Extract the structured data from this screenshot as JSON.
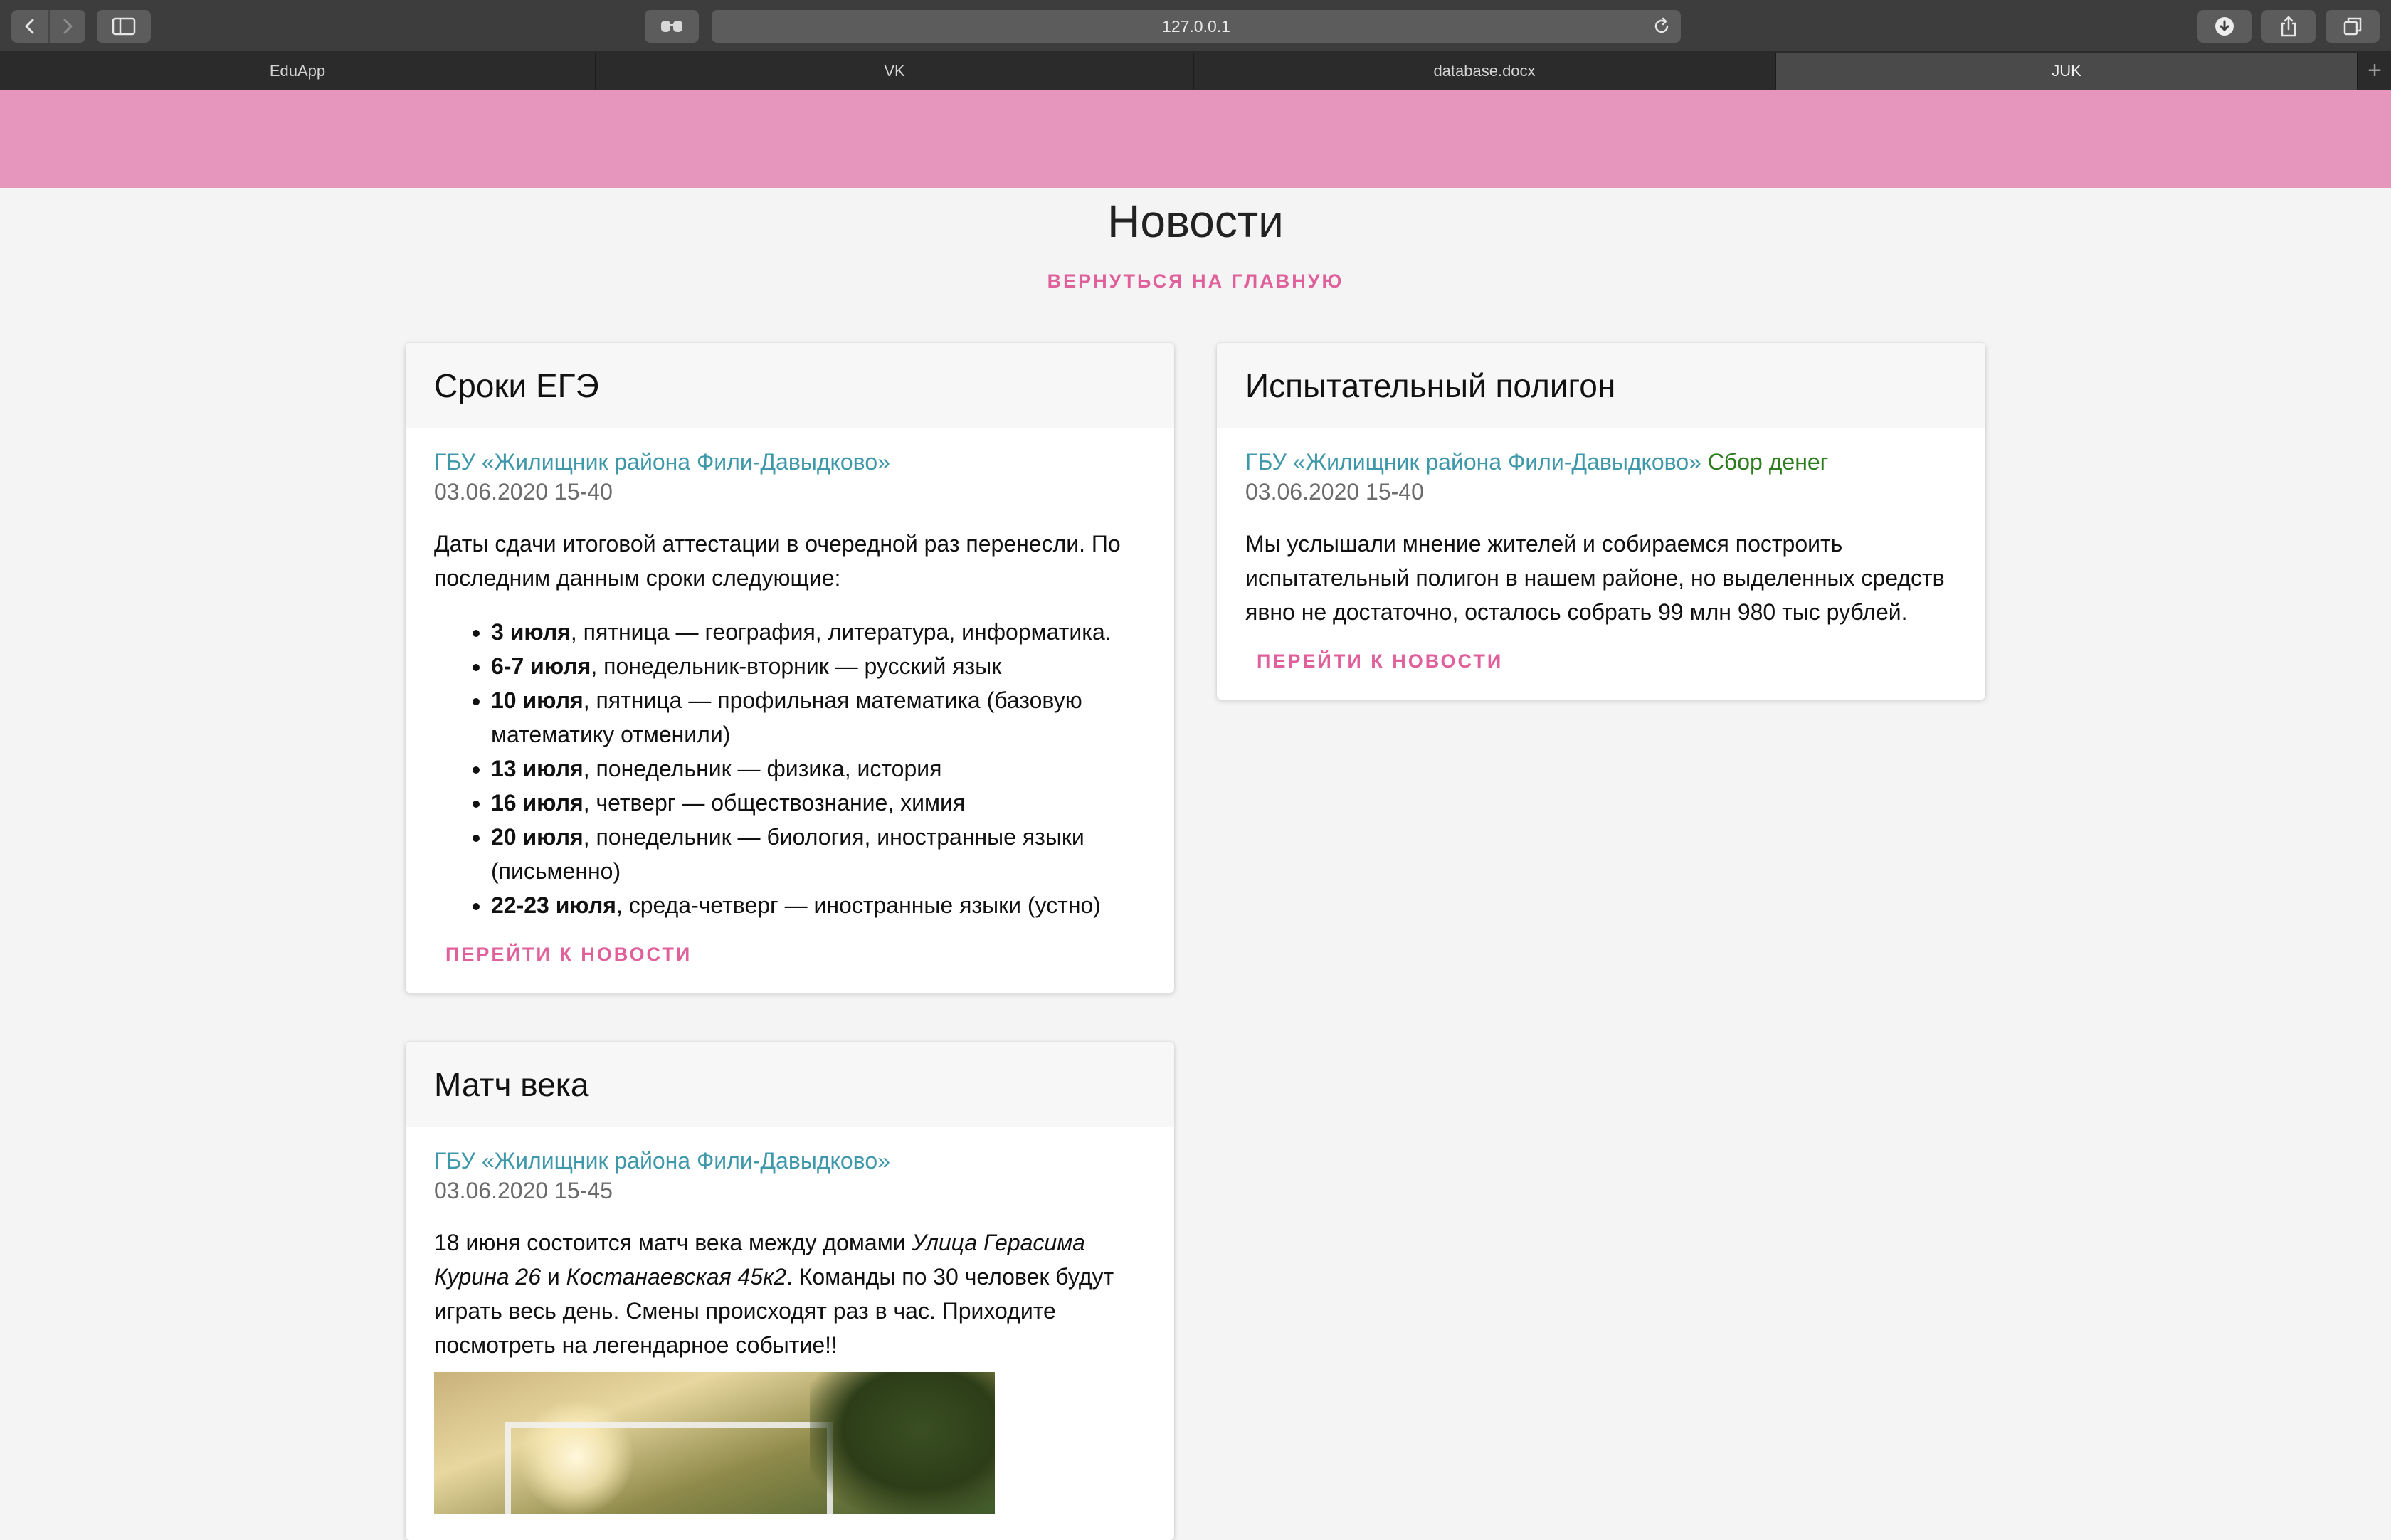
{
  "browser": {
    "url": "127.0.0.1",
    "tabs": [
      {
        "label": "EduApp",
        "active": false
      },
      {
        "label": "VK",
        "active": false
      },
      {
        "label": "database.docx",
        "active": false
      },
      {
        "label": "JUK",
        "active": true
      }
    ],
    "new_tab_symbol": "+"
  },
  "page": {
    "title": "Новости",
    "home_link": "ВЕРНУТЬСЯ НА ГЛАВНУЮ",
    "read_more": "ПЕРЕЙТИ К НОВОСТИ"
  },
  "news": [
    {
      "title": "Сроки ЕГЭ",
      "author": "ГБУ «Жилищник района Фили-Давыдково»",
      "date": "03.06.2020 15-40",
      "text": "Даты сдачи итоговой аттестации в очередной раз перенесли. По последним данным сроки следующие:",
      "items": [
        {
          "bold": "3 июля",
          "rest": ", пятница — география, литература, информатика."
        },
        {
          "bold": "6-7 июля",
          "rest": ", понедельник-вторник — русский язык"
        },
        {
          "bold": "10 июля",
          "rest": ", пятница — профильная математика (базовую математику отменили)"
        },
        {
          "bold": "13 июля",
          "rest": ", понедельник — физика, история"
        },
        {
          "bold": "16 июля",
          "rest": ", четверг — обществознание, химия"
        },
        {
          "bold": "20 июля",
          "rest": ", понедельник — биология, иностранные языки (письменно)"
        },
        {
          "bold": "22-23 июля",
          "rest": ", среда-четверг — иностранные языки (устно)"
        }
      ]
    },
    {
      "title": "Испытательный полигон",
      "author": "ГБУ «Жилищник района Фили-Давыдково»",
      "tag": "Сбор денег",
      "date": "03.06.2020 15-40",
      "text": "Мы услышали мнение жителей и собираемся построить испытательный полигон в нашем районе, но выделенных средств явно не достаточно, осталось собрать 99 млн 980 тыс рублей."
    },
    {
      "title": "Матч века",
      "author": "ГБУ «Жилищник района Фили-Давыдково»",
      "date": "03.06.2020 15-45",
      "text_parts": {
        "t1": "18 июня состоится матч века между домами ",
        "i1": "Улица Герасима Курина 26",
        "t2": " и ",
        "i2": "Костанаевская 45к2",
        "t3": ". Команды по 30 человек будут играть весь день. Смены происходят раз в час. Приходите посмотреть на легендарное событие!!"
      }
    }
  ]
}
